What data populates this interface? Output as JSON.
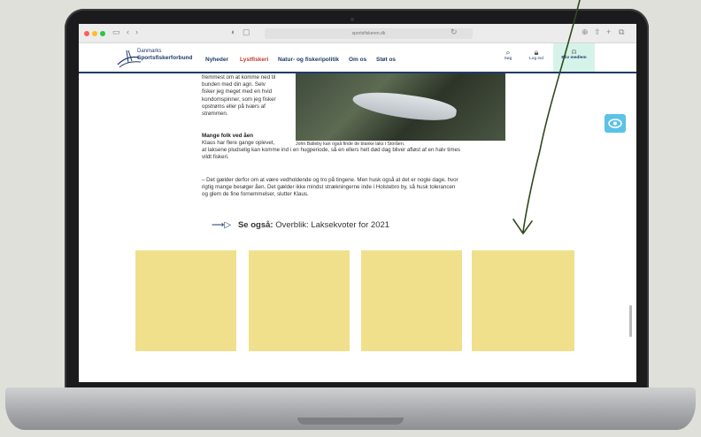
{
  "browser": {
    "url": "sportsfiskeren.dk"
  },
  "site": {
    "brand_line1": "Danmarks",
    "brand_line2": "Sportsfiskerforbund",
    "nav": [
      "Nyheder",
      "Lystfiskeri",
      "Natur- og fiskeripolitik",
      "Om os",
      "Støt os"
    ],
    "search_label": "Søg",
    "login_label": "Log ind",
    "member_label": "Bliv medlem"
  },
  "article": {
    "intro_lines": [
      "fremmest om at komme ned til",
      "bunden med din agn. Selv",
      "fisker jeg meget med en hvid",
      "kondomspinner, som jeg fisker",
      "opstrøms eller på tværs af",
      "strømmen."
    ],
    "subheading": "Mange folk ved åen",
    "body1_lines": [
      "Klaus har flere gange oplevet,",
      "at laksene pludselig kan komme ind i en hugperiode, så en ellers helt død dag bliver afløst af en halv times",
      "vildt fiskeri."
    ],
    "body2_lines": [
      "– Det gælder derfor om at være vedholdende og tro på tingene. Men husk også at det er nogle dage, hvor",
      "rigtig mange besøger åen. Det gælder ikke mindst strækningerne inde i Holstebro by, så husk tolerancen",
      "og glem de fine fornemmelser, slutter Klaus."
    ],
    "photo_caption": "John Balleby kan også finde de blanke laks i Storåen.",
    "see_also_prefix": "Se også:",
    "see_also_text": "Overblik: Laksekvoter for 2021"
  },
  "colors": {
    "brand": "#1f3a68",
    "accent": "#c0392b",
    "tile": "#f0e08c",
    "accessibility": "#5cc2e6"
  },
  "icons": {
    "search": "search-icon",
    "login": "lock-icon",
    "member": "user-plus-icon",
    "accessibility": "eye-icon"
  }
}
